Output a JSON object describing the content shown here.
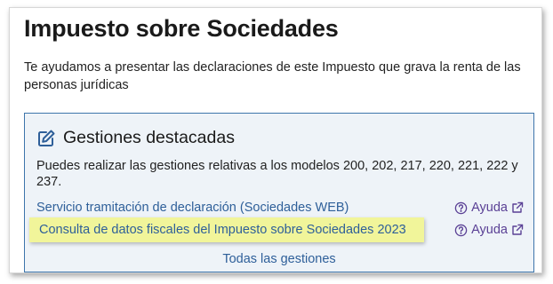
{
  "page": {
    "title": "Impuesto sobre Sociedades",
    "intro": "Te ayudamos a presentar las declaraciones de este Impuesto que grava la renta de las personas jurídicas"
  },
  "card": {
    "title": "Gestiones destacadas",
    "description": "Puedes realizar las gestiones relativas a los modelos 200, 202, 217, 220, 221, 222 y 237.",
    "links": [
      {
        "label": "Servicio tramitación de declaración (Sociedades WEB)",
        "help_label": "Ayuda"
      },
      {
        "label": "Consulta de datos fiscales del Impuesto sobre Sociedades 2023",
        "help_label": "Ayuda"
      }
    ],
    "all_label": "Todas las gestiones",
    "icon": "edit-icon"
  },
  "colors": {
    "card_border": "#3d75ab",
    "card_background": "#eef3f8",
    "link": "#2e5f99",
    "help_link": "#5a4095",
    "highlight": "#f1f59a"
  }
}
